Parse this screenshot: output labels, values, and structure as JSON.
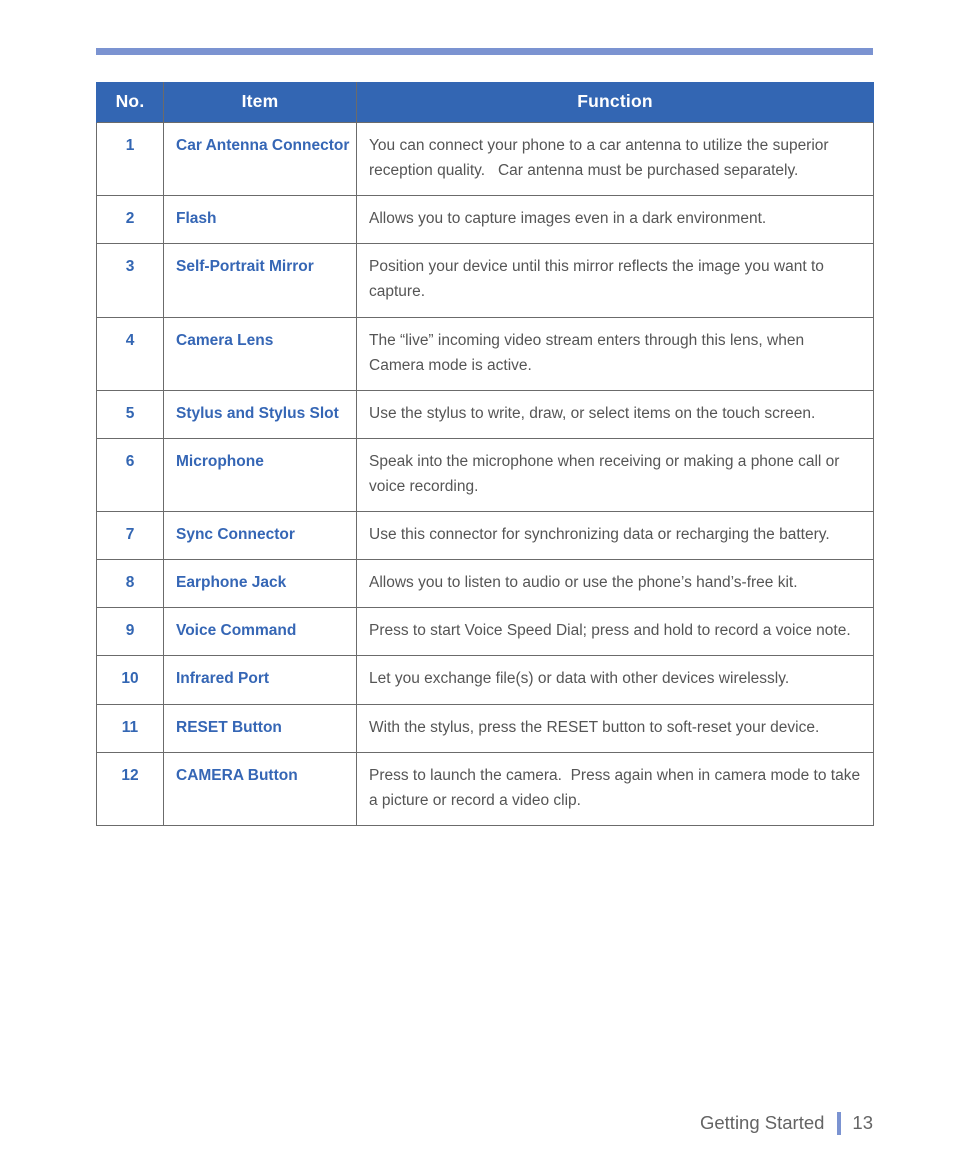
{
  "page": {
    "accent_rule_color": "#7b93d1",
    "header_color": "#3366b3",
    "item_text_color": "#3566b5",
    "function_text_color": "#555555"
  },
  "table": {
    "headers": {
      "no": "No.",
      "item": "Item",
      "function": "Function"
    },
    "rows": [
      {
        "no": "1",
        "item": "Car Antenna Connector",
        "function": "You can connect your phone to a car antenna to utilize the superior reception quality.   Car antenna must be purchased separately."
      },
      {
        "no": "2",
        "item": "Flash",
        "function": "Allows you to capture images even in a dark environment."
      },
      {
        "no": "3",
        "item": "Self-Portrait Mirror",
        "function": "Position your device until this mirror reflects the image you want to capture."
      },
      {
        "no": "4",
        "item": "Camera Lens",
        "function": "The “live” incoming video stream enters through this lens, when Camera mode is active."
      },
      {
        "no": "5",
        "item": "Stylus and Stylus Slot",
        "function": "Use the stylus to write, draw, or select items on the touch screen."
      },
      {
        "no": "6",
        "item": "Microphone",
        "function": "Speak into the microphone when receiving or making a phone call or voice recording."
      },
      {
        "no": "7",
        "item": "Sync Connector",
        "function": "Use this connector for synchronizing data or recharging the battery."
      },
      {
        "no": "8",
        "item": "Earphone Jack",
        "function": "Allows you to listen to audio or use the phone’s hand’s-free kit."
      },
      {
        "no": "9",
        "item": "Voice Command",
        "function": "Press to start Voice Speed Dial; press and hold to record a voice note."
      },
      {
        "no": "10",
        "item": "Infrared Port",
        "function": "Let you exchange file(s) or data with other devices wirelessly."
      },
      {
        "no": "11",
        "item": "RESET Button",
        "function": "With the stylus, press the RESET button to soft-reset your device."
      },
      {
        "no": "12",
        "item": "CAMERA Button",
        "function": "Press to launch the camera.  Press again when in camera mode to take a picture or record a video clip."
      }
    ]
  },
  "footer": {
    "section": "Getting Started",
    "page_number": "13"
  }
}
